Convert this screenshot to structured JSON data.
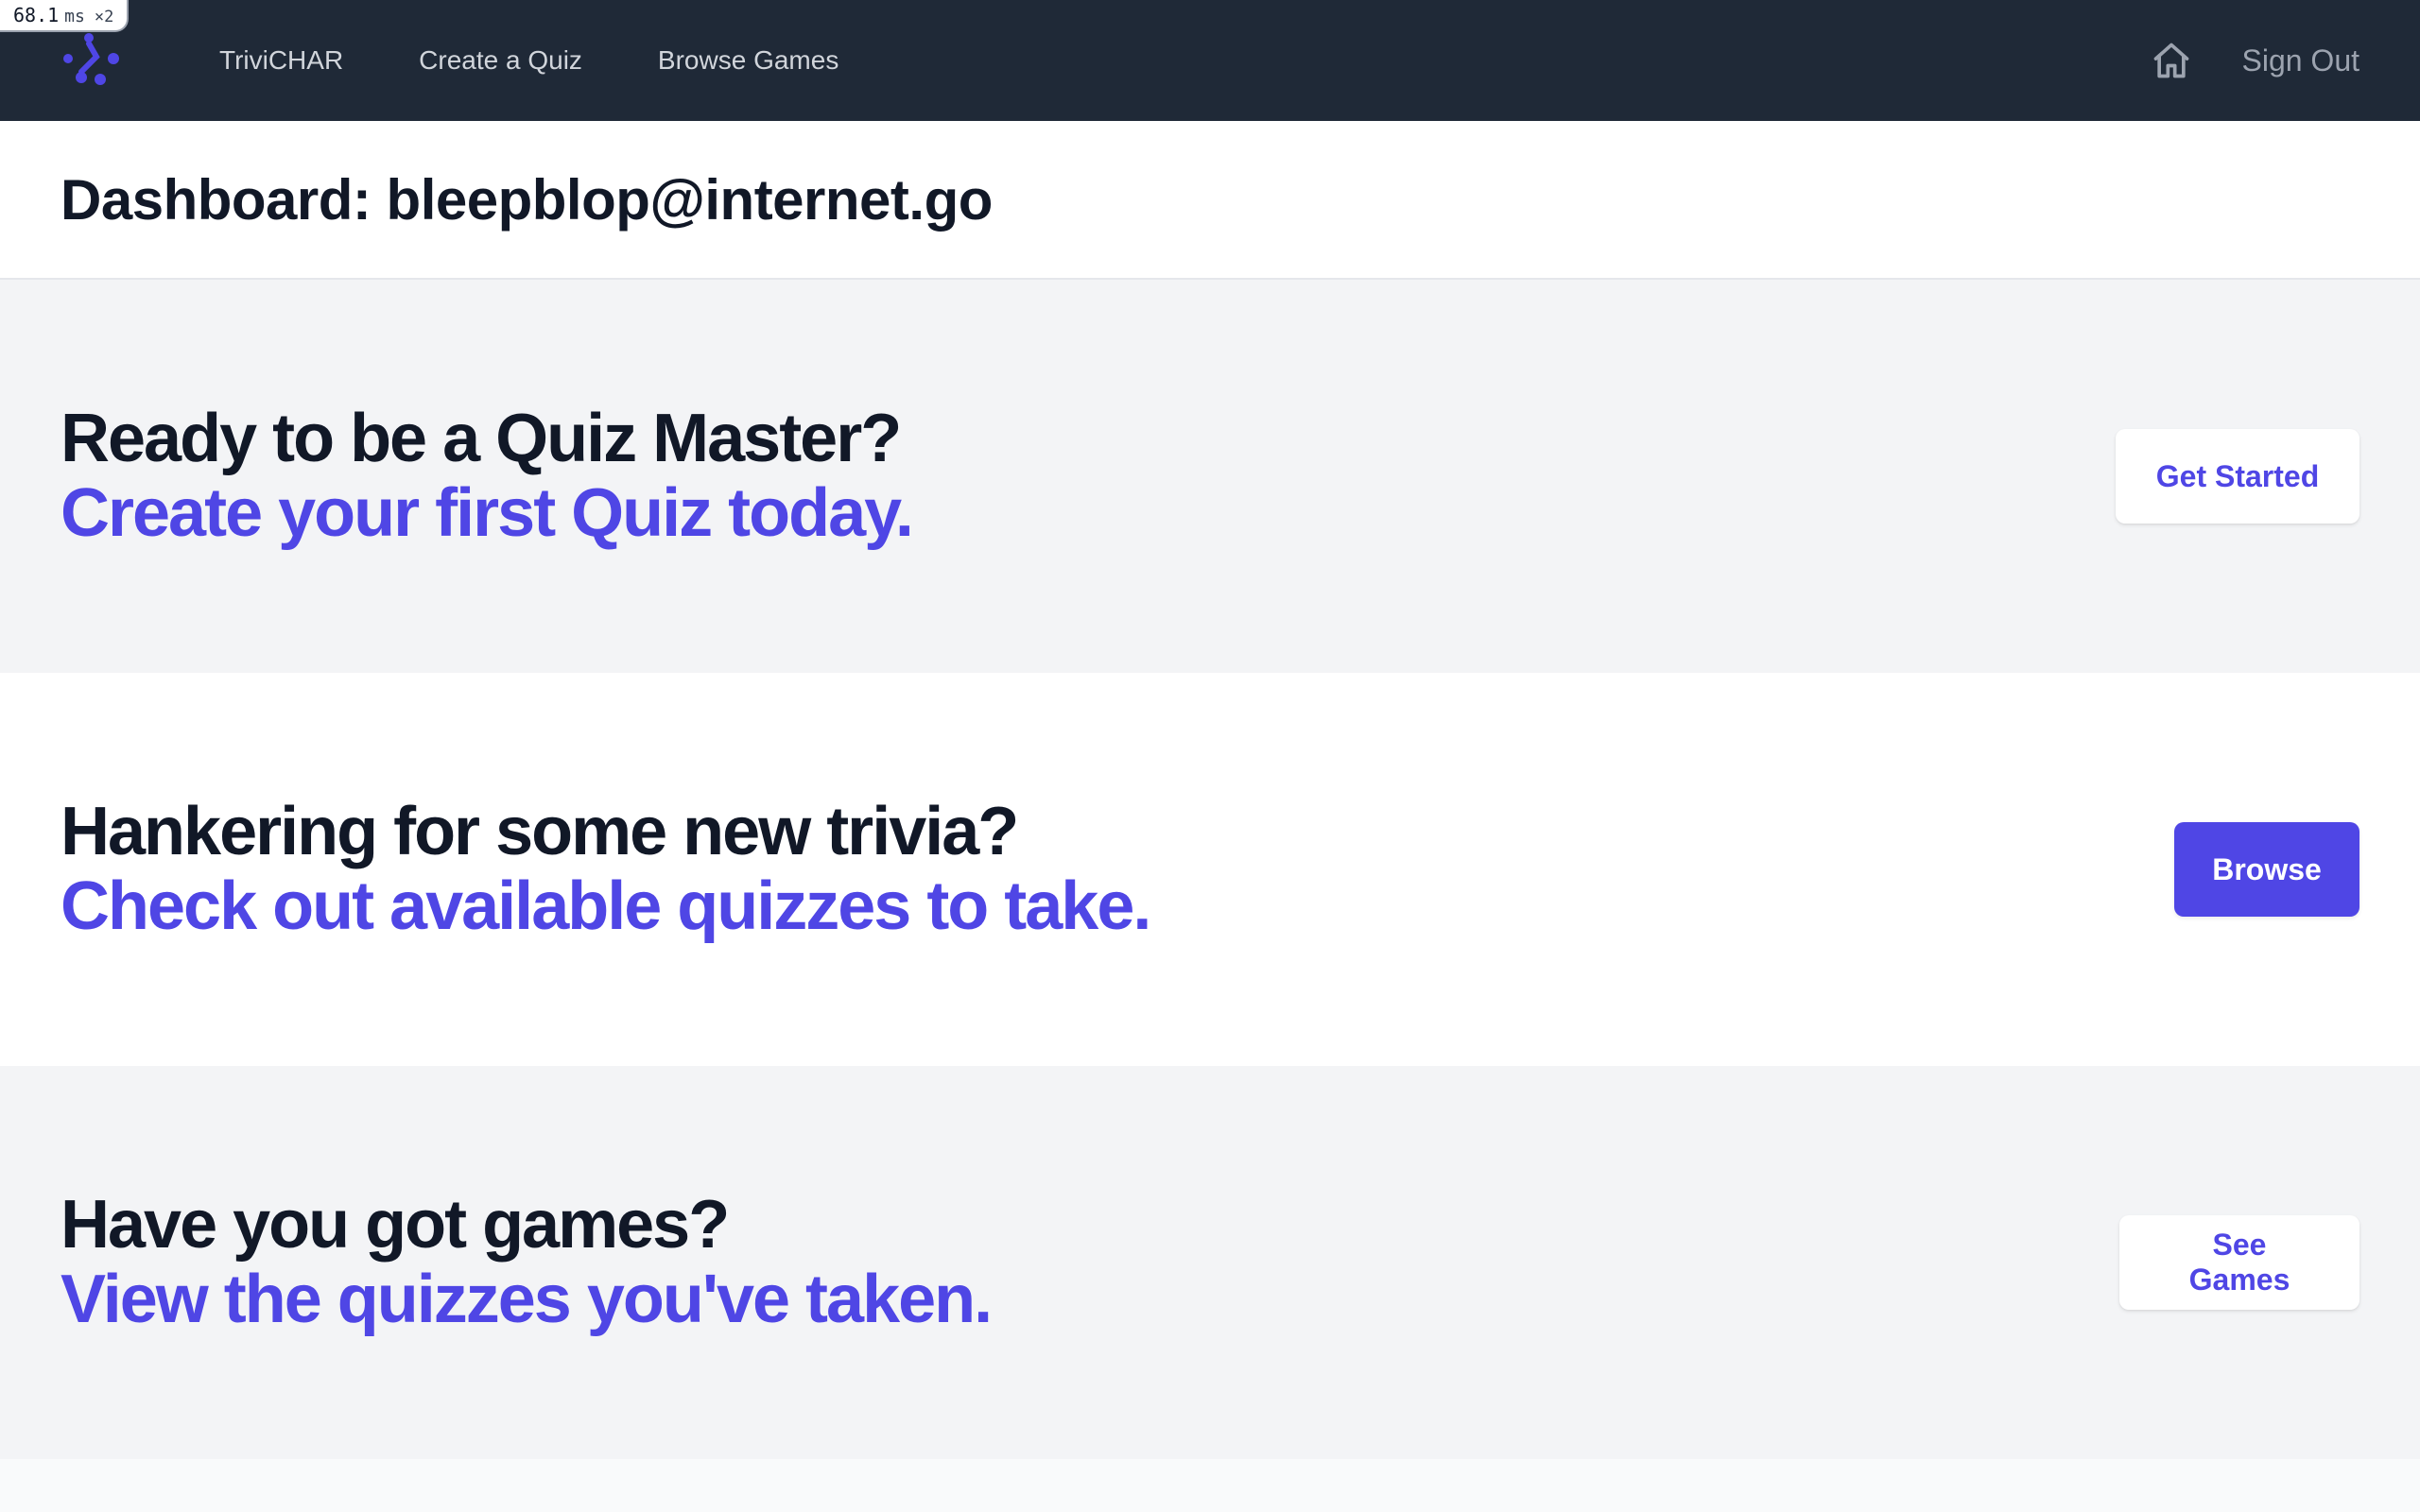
{
  "perf_badge": {
    "value": "68.1",
    "unit": "ms",
    "multiplier": "×2"
  },
  "nav": {
    "brand": "TriviCHAR",
    "links": [
      "Create a Quiz",
      "Browse Games"
    ],
    "home_icon": "home-icon",
    "sign_out": "Sign Out",
    "bg_color": "#1f2937"
  },
  "header": {
    "title": "Dashboard: bleepblop@internet.go"
  },
  "sections": [
    {
      "title": "Ready to be a Quiz Master?",
      "subtitle": "Create your first Quiz today.",
      "button": "Get Started"
    },
    {
      "title": "Hankering for some new trivia?",
      "subtitle": "Check out available quizzes to take.",
      "button": "Browse"
    },
    {
      "title": "Have you got games?",
      "subtitle": "View the quizzes you've taken.",
      "button": "See Games"
    }
  ],
  "colors": {
    "accent": "#4f46e5",
    "heading": "#111827"
  }
}
